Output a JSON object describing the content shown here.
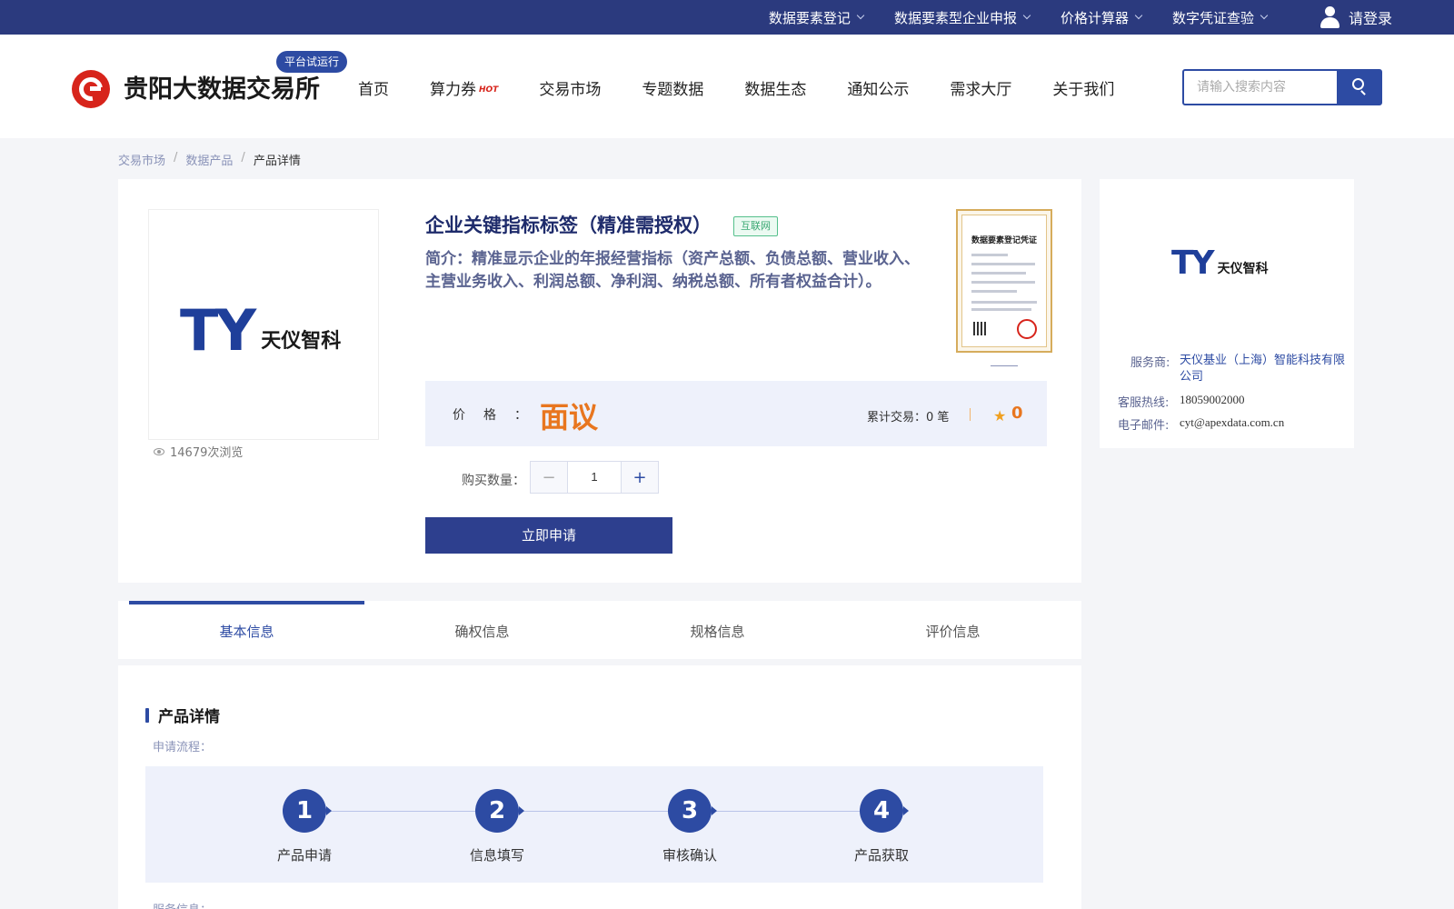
{
  "topbar": {
    "items": [
      {
        "label": "数据要素登记"
      },
      {
        "label": "数据要素型企业申报"
      },
      {
        "label": "价格计算器"
      },
      {
        "label": "数字凭证查验"
      }
    ],
    "login_label": "请登录"
  },
  "header": {
    "site_name": "贵阳大数据交易所",
    "badge": "平台试运行",
    "nav": [
      "首页",
      "算力券",
      "交易市场",
      "专题数据",
      "数据生态",
      "通知公示",
      "需求大厅",
      "关于我们"
    ],
    "hot_label": "HOT",
    "search_placeholder": "请输入搜索内容"
  },
  "breadcrumb": [
    "交易市场",
    "数据产品",
    "产品详情"
  ],
  "breadcrumb_sep": "/",
  "product": {
    "brand_letters": "TY",
    "brand_cn": "天仪智科",
    "views": "14679次浏览",
    "title": "企业关键指标标签（精准需授权）",
    "tag": "互联网",
    "intro": "简介：精准显示企业的年报经营指标（资产总额、负债总额、营业收入、主营业务收入、利润总额、净利润、纳税总额、所有者权益合计）。",
    "cert_title": "数据要素登记凭证",
    "price_label": "价格：",
    "price_value": "面议",
    "deals": "累计交易：0 笔",
    "rating": "0",
    "qty_label": "购买数量：",
    "qty": "1",
    "apply_label": "立即申请"
  },
  "provider": {
    "brand_letters": "TY",
    "brand_cn": "天仪智科",
    "rows": [
      {
        "key": "服务商:",
        "value": "天仪基业（上海）智能科技有限公司"
      },
      {
        "key": "客服热线:",
        "value": "18059002000"
      },
      {
        "key": "电子邮件:",
        "value": "cyt@apexdata.com.cn"
      }
    ]
  },
  "tabs": [
    "基本信息",
    "确权信息",
    "规格信息",
    "评价信息"
  ],
  "detail": {
    "title": "产品详情",
    "flow_label": "申请流程：",
    "steps": [
      {
        "num": "1",
        "label": "产品申请"
      },
      {
        "num": "2",
        "label": "信息填写"
      },
      {
        "num": "3",
        "label": "审核确认"
      },
      {
        "num": "4",
        "label": "产品获取"
      }
    ],
    "service_label": "服务信息："
  },
  "colors": {
    "brand_navy": "#2b3a7e",
    "accent_blue": "#2d4ba3",
    "price_orange": "#e8761f",
    "logo_red": "#d7241b"
  }
}
